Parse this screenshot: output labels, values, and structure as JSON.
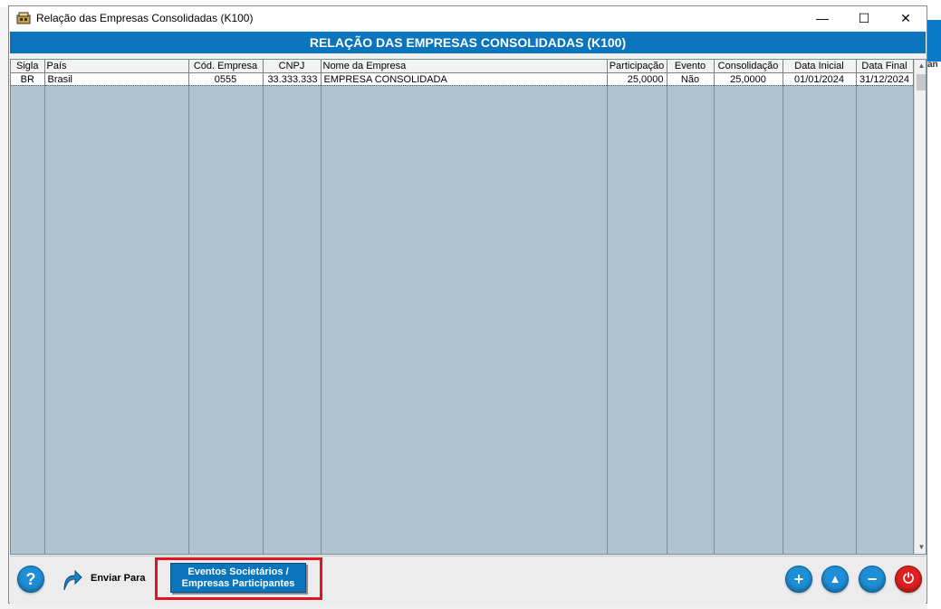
{
  "window": {
    "title": "Relação das Empresas Consolidadas (K100)",
    "minimize_glyph": "—",
    "maximize_glyph": "☐",
    "close_glyph": "✕"
  },
  "banner": {
    "text": "RELAÇÃO DAS EMPRESAS CONSOLIDADAS (K100)"
  },
  "table": {
    "columns": [
      "Sigla",
      "País",
      "Cód. Empresa",
      "CNPJ",
      "Nome da Empresa",
      "Participação",
      "Evento",
      "Consolidação",
      "Data Inicial",
      "Data Final"
    ],
    "rows": [
      [
        "BR",
        "Brasil",
        "0555",
        "33.333.333",
        "EMPRESA CONSOLIDADA",
        "25,0000",
        "Não",
        "25,0000",
        "01/01/2024",
        "31/12/2024"
      ]
    ]
  },
  "toolbar": {
    "help_glyph": "?",
    "send_label": "Enviar Para",
    "events_line1": "Eventos Societários /",
    "events_line2": "Empresas Participantes",
    "add_glyph": "+",
    "up_glyph": "▲",
    "remove_glyph": "−",
    "exit_glyph": "⏻"
  },
  "icons": {
    "app": "app-icon",
    "help": "help-icon",
    "send": "send-arrow-icon",
    "add": "add-icon",
    "move_up": "move-up-icon",
    "remove": "remove-icon",
    "exit": "power-icon"
  },
  "colors": {
    "banner": "#0a75bc",
    "grid_background": "#afc4cf",
    "highlight": "#e0141e",
    "round_button": "#1e8fd6",
    "exit_button": "#e02020"
  },
  "background_app": {
    "partial_label": "an"
  }
}
